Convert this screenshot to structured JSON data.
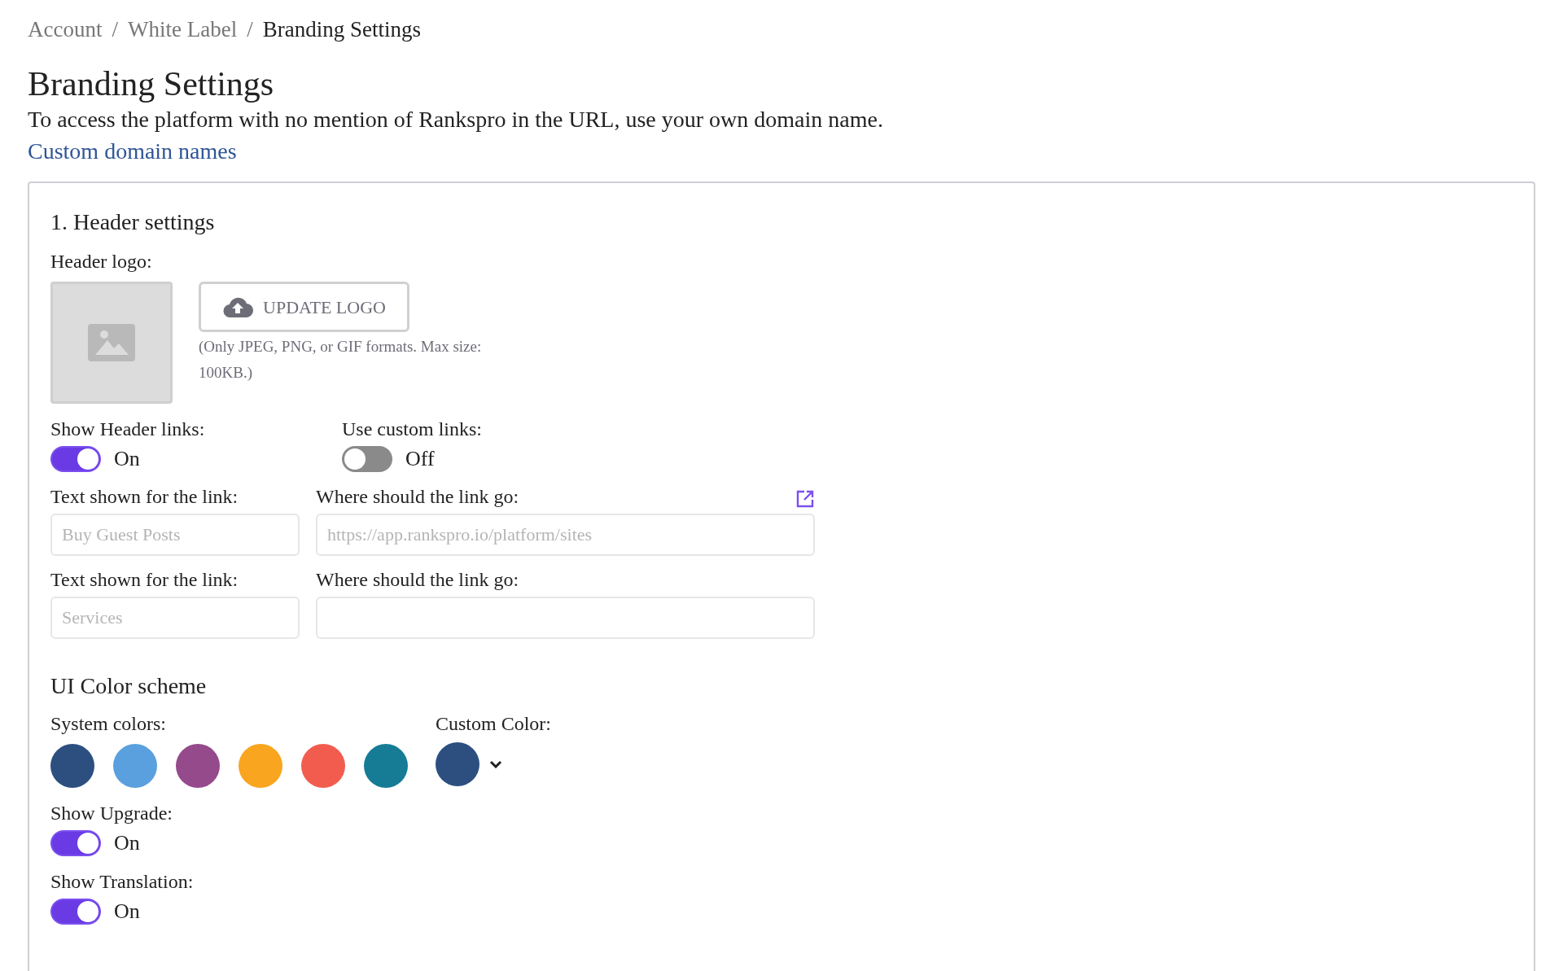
{
  "breadcrumb": [
    {
      "label": "Account",
      "current": false
    },
    {
      "label": "White Label",
      "current": false
    },
    {
      "label": "Branding Settings",
      "current": true
    }
  ],
  "breadcrumb_separator": "/",
  "title": "Branding Settings",
  "description": "To access the platform with no mention of Rankspro in the URL, use your own domain name.",
  "link": "Custom domain names",
  "header_settings": {
    "title": "1. Header settings",
    "logo_label": "Header logo:",
    "upload_button": "UPDATE LOGO",
    "upload_hint": "(Only JPEG, PNG, or GIF formats. Max size: 100KB.)",
    "toggles": [
      {
        "label": "Show Header links:",
        "on": true,
        "state_text": "On"
      },
      {
        "label": "Use custom links:",
        "on": false,
        "state_text": "Off"
      }
    ],
    "link_rows": [
      {
        "text_label": "Text shown for the link:",
        "text_placeholder": "Buy Guest Posts",
        "url_label": "Where should the link go:",
        "url_placeholder": "https://app.rankspro.io/platform/sites",
        "open_icon": true
      },
      {
        "text_label": "Text shown for the link:",
        "text_placeholder": "Services",
        "url_label": "Where should the link go:",
        "open_icon": false
      }
    ]
  },
  "color_scheme": {
    "title": "UI Color scheme",
    "system_label": "System colors:",
    "system_colors": [
      {
        "color": "#2c4f80"
      },
      {
        "color": "#5aa0de"
      },
      {
        "color": "#954a8c"
      },
      {
        "color": "#f9a51f"
      },
      {
        "color": "#f25c4f"
      },
      {
        "color": "#167c96"
      }
    ],
    "custom_label": "Custom Color:",
    "custom_swatch": {
      "color": "#2c4f80"
    }
  },
  "bottom_toggles": [
    {
      "label": "Show Upgrade:",
      "on": true,
      "state_text": "On"
    },
    {
      "label": "Show Translation:",
      "on": true,
      "state_text": "On"
    }
  ]
}
